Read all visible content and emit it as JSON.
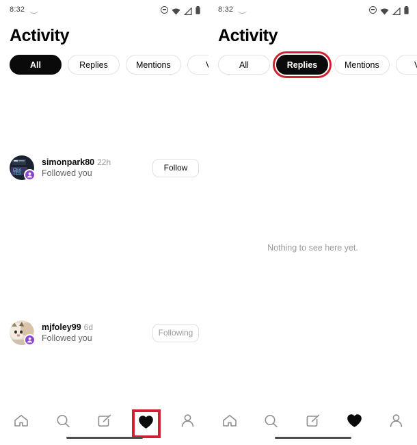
{
  "screens": [
    {
      "id": "left",
      "statusbar": {
        "time": "8:32",
        "icons": [
          "crescent-icon",
          "do-not-disturb-icon",
          "wifi-icon",
          "signal-icon",
          "battery-icon"
        ]
      },
      "title": "Activity",
      "tabs": [
        {
          "label": "All",
          "selected": true,
          "highlighted": false
        },
        {
          "label": "Replies",
          "selected": false,
          "highlighted": false
        },
        {
          "label": "Mentions",
          "selected": false,
          "highlighted": false
        },
        {
          "label": "Veri",
          "selected": false,
          "highlighted": false
        }
      ],
      "rows": [
        {
          "username": "simonpark80",
          "time": "22h",
          "subtitle": "Followed you",
          "action": "Follow",
          "action_state": "follow",
          "badge": "person-icon",
          "avatar_style": "dark-photo"
        },
        {
          "username": "mjfoley99",
          "time": "6d",
          "subtitle": "Followed you",
          "action": "Following",
          "action_state": "following",
          "badge": "person-icon",
          "avatar_style": "cat-photo"
        }
      ],
      "empty_message": null,
      "nav": [
        {
          "icon": "home-icon",
          "active": false,
          "highlighted": false
        },
        {
          "icon": "search-icon",
          "active": false,
          "highlighted": false
        },
        {
          "icon": "compose-icon",
          "active": false,
          "highlighted": false
        },
        {
          "icon": "heart-icon",
          "active": true,
          "highlighted": true
        },
        {
          "icon": "profile-icon",
          "active": false,
          "highlighted": false
        }
      ]
    },
    {
      "id": "right",
      "statusbar": {
        "time": "8:32",
        "icons": [
          "crescent-icon",
          "do-not-disturb-icon",
          "wifi-icon",
          "signal-icon",
          "battery-icon"
        ]
      },
      "title": "Activity",
      "tabs": [
        {
          "label": "All",
          "selected": false,
          "highlighted": false
        },
        {
          "label": "Replies",
          "selected": true,
          "highlighted": true
        },
        {
          "label": "Mentions",
          "selected": false,
          "highlighted": false
        },
        {
          "label": "Veri",
          "selected": false,
          "highlighted": false
        }
      ],
      "rows": [],
      "empty_message": "Nothing to see here yet.",
      "nav": [
        {
          "icon": "home-icon",
          "active": false,
          "highlighted": false
        },
        {
          "icon": "search-icon",
          "active": false,
          "highlighted": false
        },
        {
          "icon": "compose-icon",
          "active": false,
          "highlighted": false
        },
        {
          "icon": "heart-icon",
          "active": true,
          "highlighted": false
        },
        {
          "icon": "profile-icon",
          "active": false,
          "highlighted": false
        }
      ]
    }
  ],
  "colors": {
    "highlight": "#d32030",
    "selected_pill": "#0a0a0a",
    "badge_purple": "#8e44d0",
    "muted_text": "#9b9b9b"
  }
}
